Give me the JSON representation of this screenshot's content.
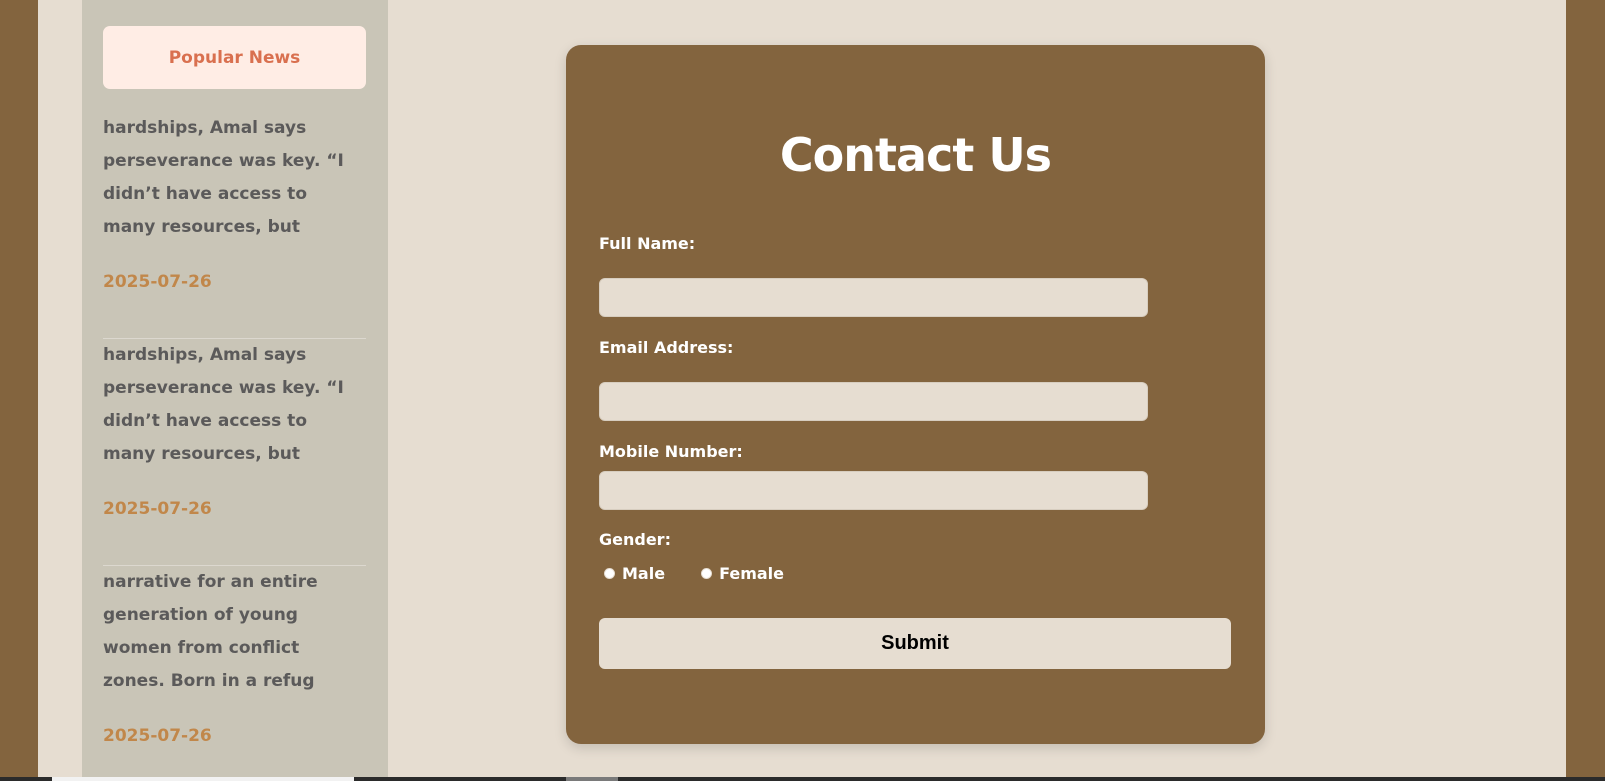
{
  "sidebar": {
    "title": "Popular News",
    "items": [
      {
        "text": "hardships, Amal says perseverance was key. “I didn’t have access to many resources, but",
        "date": "2025-07-26"
      },
      {
        "text": "hardships, Amal says perseverance was key. “I didn’t have access to many resources, but",
        "date": "2025-07-26"
      },
      {
        "text": "narrative for an entire generation of young women from conflict zones. Born in a refug",
        "date": "2025-07-26"
      }
    ]
  },
  "contact": {
    "title": "Contact Us",
    "full_name_label": "Full Name:",
    "email_label": "Email Address:",
    "mobile_label": "Mobile Number:",
    "gender_label": "Gender:",
    "gender_options": [
      "Male",
      "Female"
    ],
    "submit_label": "Submit"
  },
  "colors": {
    "frame": "#83643e",
    "page_bg": "#e6ddd1",
    "sidebar_bg": "#c9c5b7",
    "accent": "#d9704f",
    "date": "#c1874a"
  }
}
